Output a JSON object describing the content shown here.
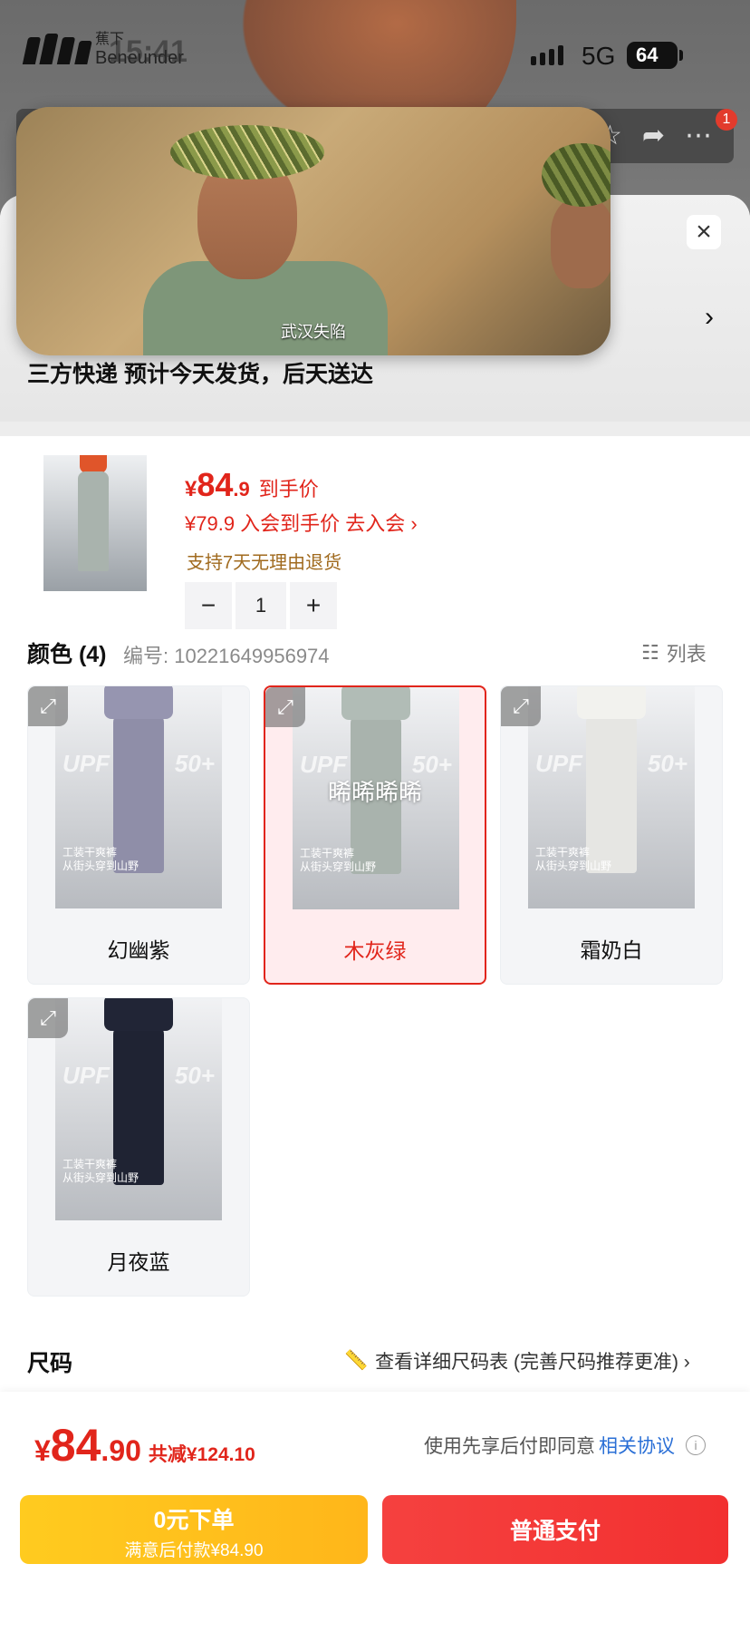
{
  "status_bar": {
    "brand_cn": "蕉下",
    "brand_en": "Beneunder",
    "time": "15:41",
    "network": "5G",
    "battery": "64",
    "notification_count": "1"
  },
  "video": {
    "subtitle": "武汉失陷"
  },
  "sheet": {
    "close_icon": "×",
    "delivery": "三方快递 预计今天发货，后天送达"
  },
  "product": {
    "price_yen": "¥",
    "price_int": "84",
    "price_dec": ".9",
    "price_label": "到手价",
    "member_price": "¥79.9 入会到手价 去入会 ›",
    "return_policy": "支持7天无理由退货",
    "quantity": "1",
    "minus": "−",
    "plus": "+"
  },
  "color_section": {
    "title": "颜色 (4)",
    "code": "编号: 10221649956974",
    "list_label": "列表",
    "swatches": [
      {
        "name": "幻幽紫",
        "pants_color": "#8f8ea8",
        "top_color": "#222"
      },
      {
        "name": "木灰绿",
        "pants_color": "#a9b3ad",
        "top_color": "#e0552a",
        "overlay": "晞晞晞晞"
      },
      {
        "name": "霜奶白",
        "pants_color": "#e6e6e3",
        "top_color": "#8a7a3a"
      },
      {
        "name": "月夜蓝",
        "pants_color": "#1f2333",
        "top_color": "#c9b63a"
      }
    ],
    "img_upf": "UPF",
    "img_upf2": "50+",
    "img_tag": "工装干爽裤\n从街头穿到山野"
  },
  "size_section": {
    "title": "尺码",
    "chart_link": "查看详细尺码表 (完善尺码推荐更准) ›"
  },
  "pay_bar": {
    "total_yen": "¥",
    "total_int": "84",
    "total_dec": ".90",
    "saving": "共减¥124.10",
    "agree_text": "使用先享后付即同意",
    "agree_link": "相关协议",
    "later_label": "0元下单",
    "later_sub": "满意后付款¥84.90",
    "pay_label": "普通支付"
  },
  "colors": {
    "accent_red": "#e1251b",
    "pay_yellow": "#ffc21d",
    "link_blue": "#2a6fd6"
  }
}
